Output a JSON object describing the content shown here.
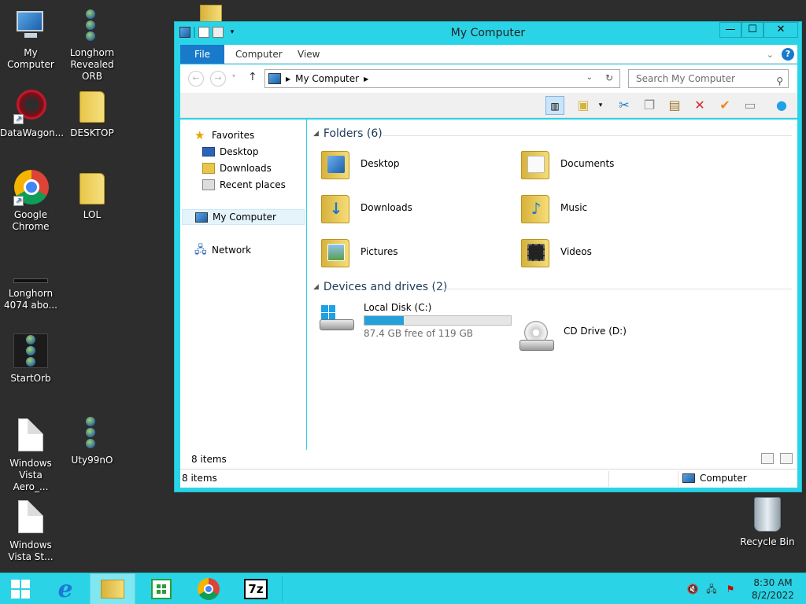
{
  "desktop": {
    "icons": [
      {
        "label": "My Computer"
      },
      {
        "label": "Longhorn Revealed ORB"
      },
      {
        "label": "DataWagon..."
      },
      {
        "label": "DESKTOP"
      },
      {
        "label": "Google Chrome"
      },
      {
        "label": "LOL"
      },
      {
        "label": "Longhorn 4074 abo..."
      },
      {
        "label": "StartOrb"
      },
      {
        "label": "Windows Vista Aero_..."
      },
      {
        "label": "Uty99nO"
      },
      {
        "label": "Windows Vista St..."
      }
    ],
    "recycle_bin": "Recycle Bin"
  },
  "window": {
    "title": "My Computer",
    "controls": {
      "minimize": "—",
      "maximize": "☐",
      "close": "✕"
    },
    "tabs": [
      "File",
      "Computer",
      "View"
    ],
    "address": {
      "crumb": "My Computer"
    },
    "search": {
      "placeholder": "Search My Computer"
    },
    "nav": {
      "favorites": "Favorites",
      "desktop": "Desktop",
      "downloads": "Downloads",
      "recent": "Recent places",
      "computer": "My Computer",
      "network": "Network"
    },
    "groups": {
      "folders": "Folders (6)",
      "drives": "Devices and drives (2)"
    },
    "folders": [
      {
        "label": "Desktop",
        "icon": "desktop-folder-icon"
      },
      {
        "label": "Documents",
        "icon": "documents-folder-icon"
      },
      {
        "label": "Downloads",
        "icon": "downloads-folder-icon"
      },
      {
        "label": "Music",
        "icon": "music-folder-icon"
      },
      {
        "label": "Pictures",
        "icon": "pictures-folder-icon"
      },
      {
        "label": "Videos",
        "icon": "videos-folder-icon"
      }
    ],
    "drives": [
      {
        "label": "Local Disk (C:)",
        "free": "87.4 GB free of 119 GB",
        "used_fraction": 0.27
      },
      {
        "label": "CD Drive (D:)"
      }
    ],
    "item_count": "8 items",
    "status": {
      "left": "8 items",
      "right": "Computer"
    }
  },
  "taskbar": {
    "time": "8:30 AM",
    "date": "8/2/2022",
    "apps": [
      "start",
      "internet-explorer",
      "file-explorer",
      "store",
      "chrome",
      "7zip"
    ],
    "sevenzip_label": "7z"
  },
  "colors": {
    "accent": "#2ad4e6",
    "file_tab": "#1979ca",
    "group_header": "#1e395b"
  }
}
